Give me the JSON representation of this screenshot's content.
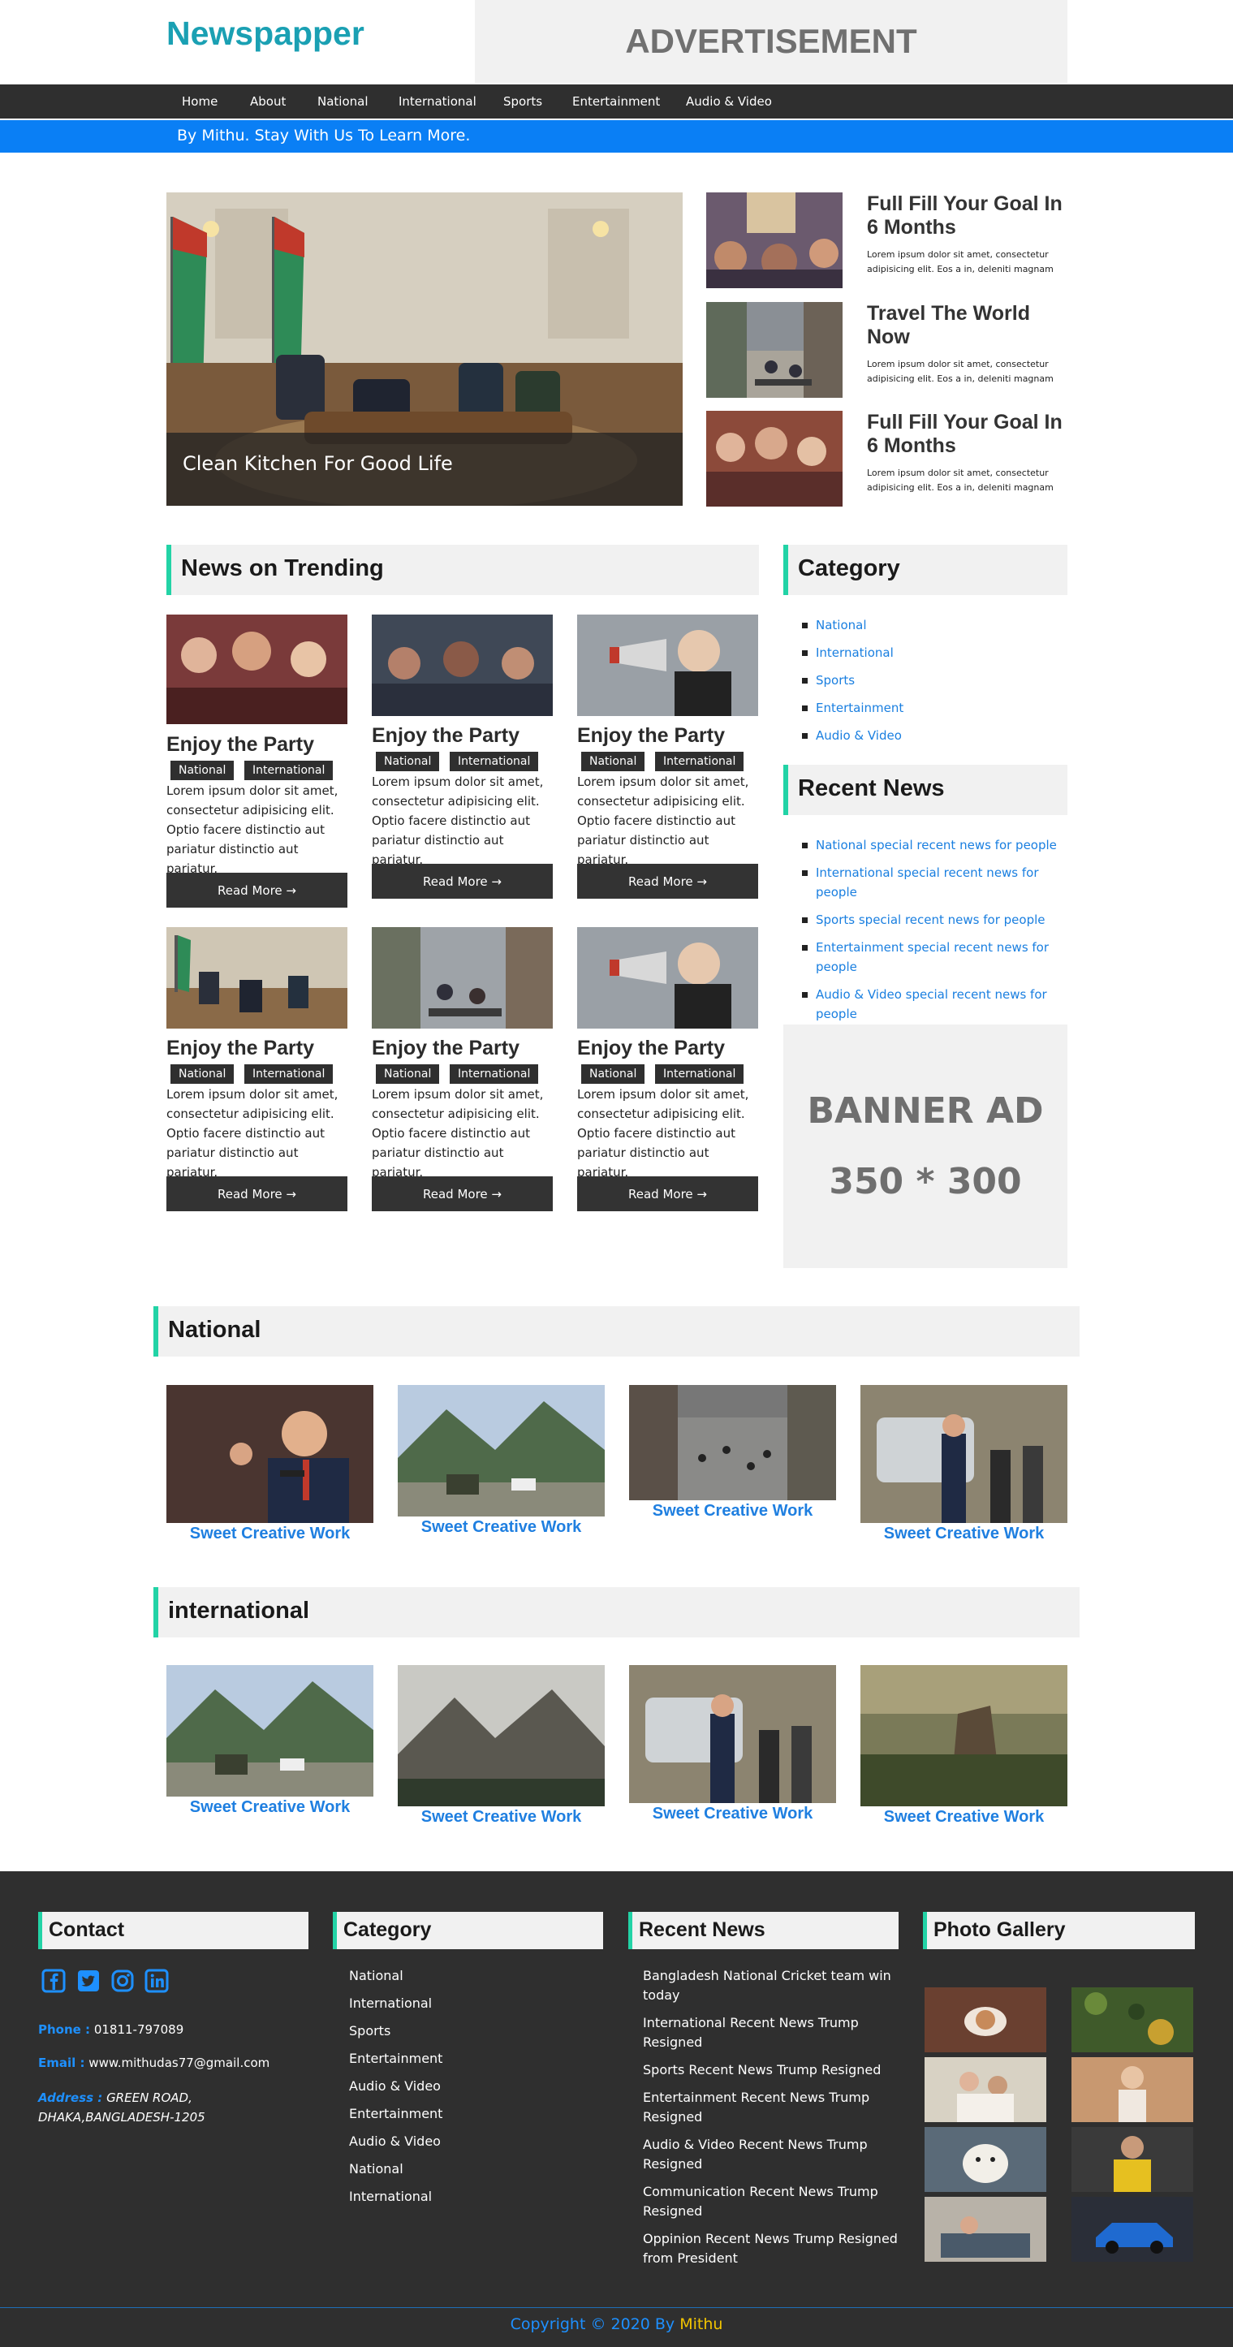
{
  "header": {
    "logo": "Newspapper",
    "ad": "ADVERTISEMENT"
  },
  "nav": [
    "Home",
    "About",
    "National",
    "International",
    "Sports",
    "Entertainment",
    "Audio & Video"
  ],
  "ticker": "By Mithu. Stay With Us To Learn More.",
  "hero": {
    "caption": "Clean Kitchen For Good Life"
  },
  "side_news": [
    {
      "title": "Full Fill Your Goal In 6 Months",
      "text": "Lorem ipsum dolor sit amet, consectetur adipisicing elit. Eos a in, deleniti magnam"
    },
    {
      "title": "Travel The World Now",
      "text": "Lorem ipsum dolor sit amet, consectetur adipisicing elit. Eos a in, deleniti magnam"
    },
    {
      "title": "Full Fill Your Goal In 6 Months",
      "text": "Lorem ipsum dolor sit amet, consectetur adipisicing elit. Eos a in, deleniti magnam"
    }
  ],
  "trending": {
    "heading": "News on Trending",
    "cards": [
      {
        "title": "Enjoy the Party",
        "tags": [
          "National",
          "International"
        ],
        "text": "Lorem ipsum dolor sit amet, consectetur adipisicing elit. Optio facere distinctio aut pariatur distinctio aut pariatur.",
        "button": "Read More →"
      },
      {
        "title": "Enjoy the Party",
        "tags": [
          "National",
          "International"
        ],
        "text": "Lorem ipsum dolor sit amet, consectetur adipisicing elit. Optio facere distinctio aut pariatur distinctio aut pariatur.",
        "button": "Read More →"
      },
      {
        "title": "Enjoy the Party",
        "tags": [
          "National",
          "International"
        ],
        "text": "Lorem ipsum dolor sit amet, consectetur adipisicing elit. Optio facere distinctio aut pariatur distinctio aut pariatur.",
        "button": "Read More →"
      },
      {
        "title": "Enjoy the Party",
        "tags": [
          "National",
          "International"
        ],
        "text": "Lorem ipsum dolor sit amet, consectetur adipisicing elit. Optio facere distinctio aut pariatur distinctio aut pariatur.",
        "button": "Read More →"
      },
      {
        "title": "Enjoy the Party",
        "tags": [
          "National",
          "International"
        ],
        "text": "Lorem ipsum dolor sit amet, consectetur adipisicing elit. Optio facere distinctio aut pariatur distinctio aut pariatur.",
        "button": "Read More →"
      },
      {
        "title": "Enjoy the Party",
        "tags": [
          "National",
          "International"
        ],
        "text": "Lorem ipsum dolor sit amet, consectetur adipisicing elit. Optio facere distinctio aut pariatur distinctio aut pariatur.",
        "button": "Read More →"
      }
    ]
  },
  "category": {
    "heading": "Category",
    "items": [
      "National",
      "International",
      "Sports",
      "Entertainment",
      "Audio & Video"
    ]
  },
  "recent": {
    "heading": "Recent News",
    "items": [
      "National special recent news for people",
      "International special recent news for people",
      "Sports special recent news for people",
      "Entertainment special recent news for people",
      "Audio & Video special recent news for people"
    ]
  },
  "banner": {
    "line1": "BANNER AD",
    "line2": "350 * 300"
  },
  "national": {
    "heading": "National",
    "items": [
      "Sweet Creative Work",
      "Sweet Creative Work",
      "Sweet Creative Work",
      "Sweet Creative Work"
    ]
  },
  "international": {
    "heading": "international",
    "items": [
      "Sweet Creative Work",
      "Sweet Creative Work",
      "Sweet Creative Work",
      "Sweet Creative Work"
    ]
  },
  "footer": {
    "contact": {
      "heading": "Contact",
      "phone_label": "Phone :",
      "phone": "01811-797089",
      "email_label": "Email :",
      "email": "www.mithudas77@gmail.com",
      "address_label": "Address :",
      "address": "GREEN ROAD, DHAKA,BANGLADESH-1205",
      "icons": [
        "facebook-icon",
        "twitter-icon",
        "instagram-icon",
        "linkedin-icon"
      ]
    },
    "category": {
      "heading": "Category",
      "items": [
        "National",
        "International",
        "Sports",
        "Entertainment",
        "Audio & Video",
        "Entertainment",
        "Audio & Video",
        "National",
        "International"
      ]
    },
    "recent": {
      "heading": "Recent News",
      "items": [
        "Bangladesh National Cricket team win today",
        "International Recent News Trump Resigned",
        "Sports Recent News Trump Resigned",
        "Entertainment Recent News Trump Resigned",
        "Audio & Video Recent News Trump Resigned",
        "Communication Recent News Trump Resigned",
        "Oppinion Recent News Trump Resigned from President"
      ]
    },
    "gallery": {
      "heading": "Photo Gallery"
    },
    "copyright": "Copyright © 2020 By",
    "author": "Mithu"
  },
  "colors": {
    "accent": "#1aa0b3",
    "ticker": "#0a7ff5",
    "link": "#1f7fe0",
    "section_border": "#22d3a6",
    "dark": "#2f2f2f"
  }
}
